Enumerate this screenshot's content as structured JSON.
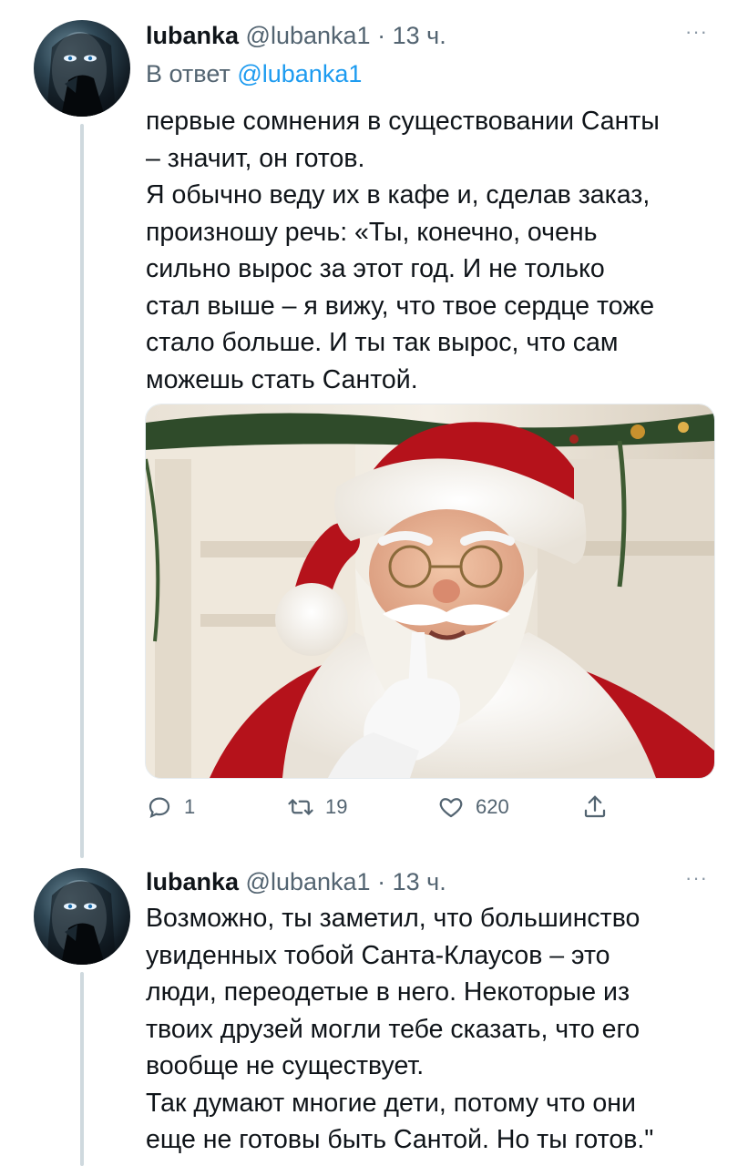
{
  "tweets": [
    {
      "author": {
        "name": "lubanka",
        "handle": "@lubanka1",
        "separator": "·",
        "time": "13 ч.",
        "avatar_icon": "user-avatar-icon"
      },
      "more_label": "···",
      "reply_prefix": "В ответ",
      "reply_mention": "@lubanka1",
      "text_lines": [
        "первые сомнения в существовании Санты",
        "– значит, он готов.",
        "Я обычно веду их в кафе и, сделав заказ,",
        "произношу речь: «Ты, конечно, очень",
        "сильно вырос за этот год. И не только",
        "стал выше – я вижу, что твое сердце тоже",
        "стало больше. И ты так вырос, что сам",
        "можешь стать Сантой."
      ],
      "media_icon": "santa-claus-photo",
      "actions": {
        "reply": {
          "icon": "reply-bubble-icon",
          "count": "1"
        },
        "retweet": {
          "icon": "retweet-icon",
          "count": "19"
        },
        "like": {
          "icon": "heart-icon",
          "count": "620"
        },
        "share": {
          "icon": "share-icon"
        }
      }
    },
    {
      "author": {
        "name": "lubanka",
        "handle": "@lubanka1",
        "separator": "·",
        "time": "13 ч.",
        "avatar_icon": "user-avatar-icon"
      },
      "more_label": "···",
      "text_lines": [
        "Возможно, ты заметил, что большинство",
        "увиденных тобой Санта-Клаусов – это",
        "люди, переодетые в него. Некоторые из",
        "твоих друзей могли тебе сказать, что его",
        "вообще не существует.",
        "Так думают многие дети, потому что они",
        "еще не готовы быть Сантой. Но ты готов.\""
      ]
    }
  ],
  "colors": {
    "text": "#0f1419",
    "secondary": "#536471",
    "link": "#1d9bf0",
    "thread_line": "#cfd9de",
    "santa_red": "#b5121b"
  }
}
